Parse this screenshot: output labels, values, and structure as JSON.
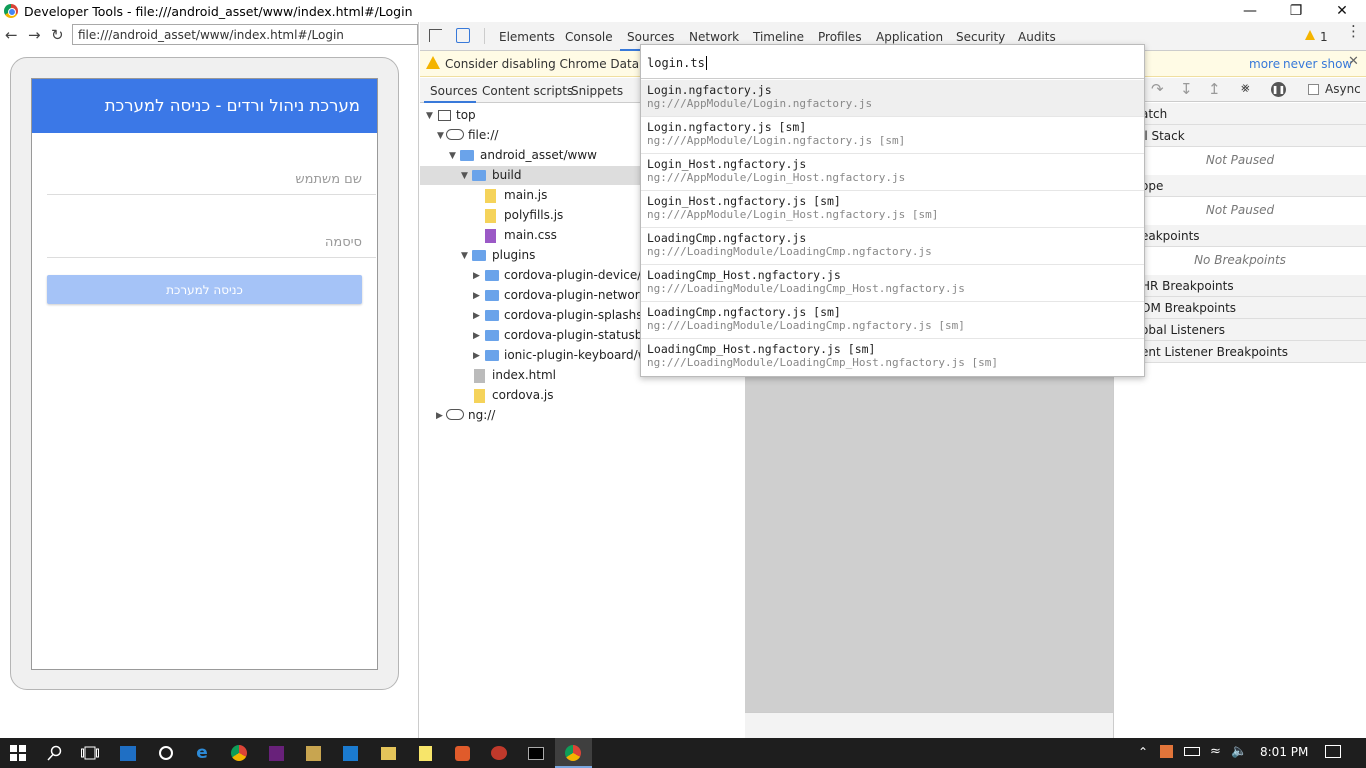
{
  "window": {
    "title": "Developer Tools - file:///android_asset/www/index.html#/Login",
    "minimize": "—",
    "restore": "❐",
    "close": "✕"
  },
  "browser": {
    "back": "←",
    "forward": "→",
    "reload": "↻",
    "address": "file:///android_asset/www/index.html#/Login"
  },
  "app": {
    "header": "מערכת ניהול ורדים - כניסה למערכת",
    "username_placeholder": "שם משתמש",
    "password_placeholder": "סיסמה",
    "login_button": "כניסה למערכת"
  },
  "devtools": {
    "tabs": [
      "Elements",
      "Console",
      "Sources",
      "Network",
      "Timeline",
      "Profiles",
      "Application",
      "Security",
      "Audits"
    ],
    "active_tab": "Sources",
    "warning_count": "1",
    "warning_text": "Consider disabling Chrome Data Save",
    "warning_more": "more",
    "warning_never": "never show",
    "sub_tabs": [
      "Sources",
      "Content scripts",
      "Snippets"
    ],
    "tree": [
      {
        "label": "top",
        "depth": 0
      },
      {
        "label": "file://",
        "depth": 1
      },
      {
        "label": "android_asset/www",
        "depth": 2
      },
      {
        "label": "build",
        "depth": 3
      },
      {
        "label": "main.js",
        "depth": 4
      },
      {
        "label": "polyfills.js",
        "depth": 4
      },
      {
        "label": "main.css",
        "depth": 4
      },
      {
        "label": "plugins",
        "depth": 3
      },
      {
        "label": "cordova-plugin-device/ww",
        "depth": 4
      },
      {
        "label": "cordova-plugin-network-i",
        "depth": 4
      },
      {
        "label": "cordova-plugin-splashscre",
        "depth": 4
      },
      {
        "label": "cordova-plugin-statusbar/",
        "depth": 4
      },
      {
        "label": "ionic-plugin-keyboard/wv",
        "depth": 4
      },
      {
        "label": "index.html",
        "depth": 3
      },
      {
        "label": "cordova.js",
        "depth": 3
      },
      {
        "label": "ng://",
        "depth": 1
      }
    ],
    "async_label": "Async",
    "right_panel": [
      {
        "title": "atch"
      },
      {
        "title": "ll Stack",
        "body": "Not Paused"
      },
      {
        "title": "ope",
        "body": "Not Paused"
      },
      {
        "title": "eakpoints",
        "body": "No Breakpoints"
      },
      {
        "title": "HR Breakpoints"
      },
      {
        "title": "OM Breakpoints"
      },
      {
        "title": "obal Listeners"
      },
      {
        "title": "ent Listener Breakpoints"
      }
    ]
  },
  "quick_open": {
    "query": "login.ts",
    "results": [
      {
        "title": "Login.ngfactory.js",
        "subtitle": "ng:///AppModule/Login.ngfactory.js"
      },
      {
        "title": "Login.ngfactory.js [sm]",
        "subtitle": "ng:///AppModule/Login.ngfactory.js [sm]"
      },
      {
        "title": "Login_Host.ngfactory.js",
        "subtitle": "ng:///AppModule/Login_Host.ngfactory.js"
      },
      {
        "title": "Login_Host.ngfactory.js [sm]",
        "subtitle": "ng:///AppModule/Login_Host.ngfactory.js [sm]"
      },
      {
        "title": "LoadingCmp.ngfactory.js",
        "subtitle": "ng:///LoadingModule/LoadingCmp.ngfactory.js"
      },
      {
        "title": "LoadingCmp_Host.ngfactory.js",
        "subtitle": "ng:///LoadingModule/LoadingCmp_Host.ngfactory.js"
      },
      {
        "title": "LoadingCmp.ngfactory.js [sm]",
        "subtitle": "ng:///LoadingModule/LoadingCmp.ngfactory.js [sm]"
      },
      {
        "title": "LoadingCmp_Host.ngfactory.js [sm]",
        "subtitle": "ng:///LoadingModule/LoadingCmp_Host.ngfactory.js [sm]"
      }
    ]
  },
  "taskbar": {
    "time": "8:01 PM"
  }
}
